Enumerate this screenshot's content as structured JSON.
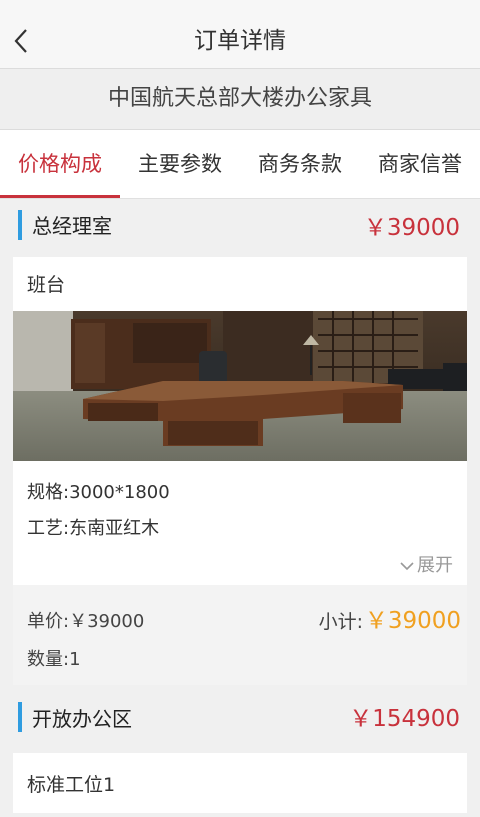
{
  "nav": {
    "title": "订单详情"
  },
  "project_title": "中国航天总部大楼办公家具",
  "tabs": [
    {
      "label": "价格构成",
      "active": true
    },
    {
      "label": "主要参数",
      "active": false
    },
    {
      "label": "商务条款",
      "active": false
    },
    {
      "label": "商家信誉",
      "active": false
    }
  ],
  "sections": [
    {
      "name": "总经理室",
      "total": "￥39000",
      "item": {
        "name": "班台",
        "spec": "规格:3000*1800",
        "craft": "工艺:东南亚红木",
        "expand": "展开",
        "unit_price": "单价:￥39000",
        "subtotal_label": "小计:",
        "subtotal": "￥39000",
        "quantity": "数量:1"
      }
    },
    {
      "name": "开放办公区",
      "total": "￥154900",
      "item": {
        "name": "标准工位1"
      }
    }
  ],
  "colors": {
    "accent": "#c8323c",
    "section_bar": "#2f9ce0",
    "subtotal": "#f0a020"
  },
  "icons": {
    "back": "chevron-left-icon",
    "expand": "chevron-down-icon"
  }
}
